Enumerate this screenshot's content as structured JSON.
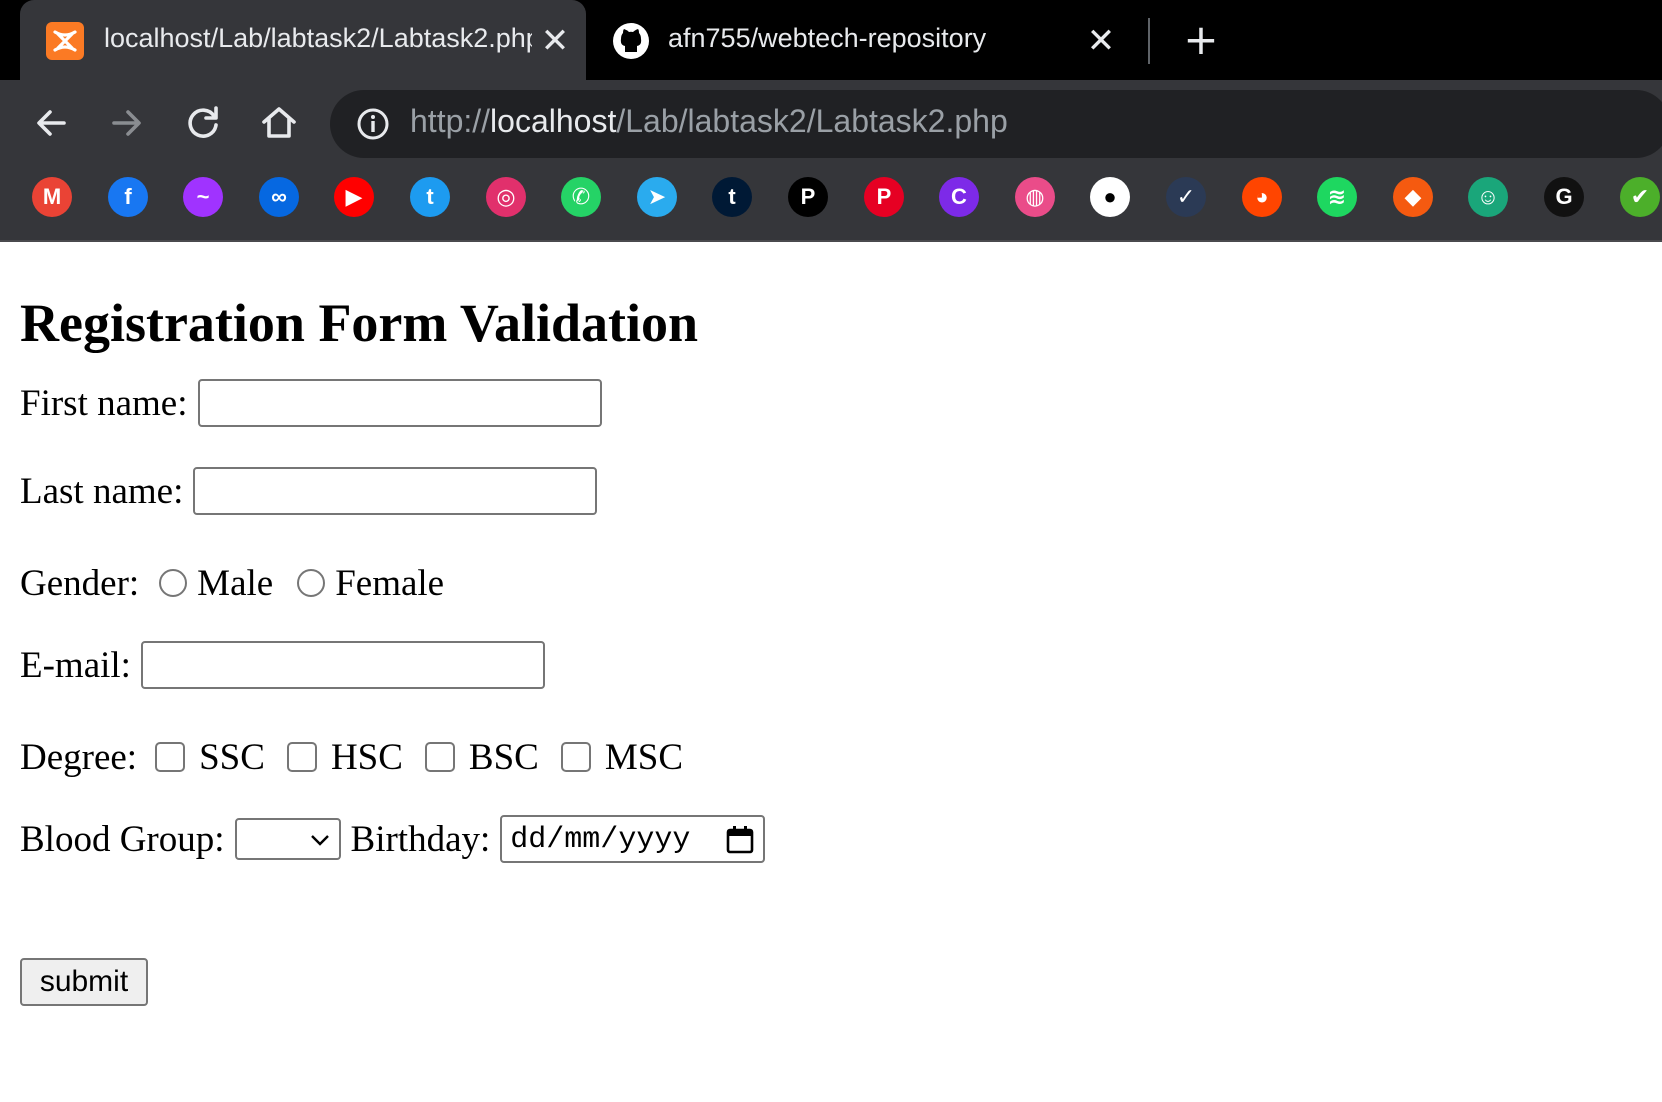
{
  "browser": {
    "tabs": [
      {
        "title": "localhost/Lab/labtask2/Labtask2.php",
        "favicon": "xampp-icon",
        "active": true
      },
      {
        "title": "afn755/webtech-repository",
        "favicon": "github-icon",
        "active": false
      }
    ],
    "close_symbol": "✕",
    "new_tab_symbol": "+",
    "address": {
      "scheme": "http://",
      "host": "localhost",
      "path": "/Lab/labtask2/Labtask2.php"
    },
    "bookmarks": [
      {
        "icon": "gmail-icon",
        "color": "#ea4335",
        "glyph": "M"
      },
      {
        "icon": "facebook-icon",
        "color": "#1877f2",
        "glyph": "f"
      },
      {
        "icon": "messenger-icon",
        "color": "#a033ff",
        "glyph": "~"
      },
      {
        "icon": "meta-icon",
        "color": "#0668e1",
        "glyph": "∞"
      },
      {
        "icon": "youtube-icon",
        "color": "#ff0000",
        "glyph": "▶"
      },
      {
        "icon": "twitter-icon",
        "color": "#1d9bf0",
        "glyph": "t"
      },
      {
        "icon": "instagram-icon",
        "color": "#e1306c",
        "glyph": "◎"
      },
      {
        "icon": "whatsapp-icon",
        "color": "#25d366",
        "glyph": "✆"
      },
      {
        "icon": "telegram-icon",
        "color": "#2aabee",
        "glyph": "➤"
      },
      {
        "icon": "tumblr-icon",
        "color": "#001935",
        "glyph": "t"
      },
      {
        "icon": "patreon-icon",
        "color": "#000000",
        "glyph": "P"
      },
      {
        "icon": "pinterest-icon",
        "color": "#e60023",
        "glyph": "P"
      },
      {
        "icon": "canva-icon",
        "color": "#7d2ae8",
        "glyph": "C"
      },
      {
        "icon": "dribbble-icon",
        "color": "#ea4c89",
        "glyph": "◍"
      },
      {
        "icon": "github-icon",
        "color": "#ffffff",
        "glyph": "●"
      },
      {
        "icon": "vk-icon",
        "color": "#2b3a55",
        "glyph": "✓"
      },
      {
        "icon": "reddit-icon",
        "color": "#ff4500",
        "glyph": "◕"
      },
      {
        "icon": "spotify-icon",
        "color": "#1ed760",
        "glyph": "≋"
      },
      {
        "icon": "bandlab-icon",
        "color": "#f55a10",
        "glyph": "◆"
      },
      {
        "icon": "messaging-app-icon",
        "color": "#1aa67a",
        "glyph": "☺"
      },
      {
        "icon": "grammarly-icon",
        "color": "#111111",
        "glyph": "G"
      },
      {
        "icon": "shield-icon",
        "color": "#4caf2a",
        "glyph": "✔"
      }
    ]
  },
  "form": {
    "heading": "Registration Form Validation",
    "first_name_label": "First name:",
    "last_name_label": "Last name:",
    "gender_label": "Gender:",
    "gender_options": [
      "Male",
      "Female"
    ],
    "email_label": "E-mail:",
    "degree_label": "Degree:",
    "degree_options": [
      "SSC",
      "HSC",
      "BSC",
      "MSC"
    ],
    "blood_group_label": "Blood Group:",
    "blood_group_value": "",
    "birthday_label": "Birthday:",
    "birthday_placeholder": "dd/mm/yyyy",
    "submit_label": "submit"
  }
}
